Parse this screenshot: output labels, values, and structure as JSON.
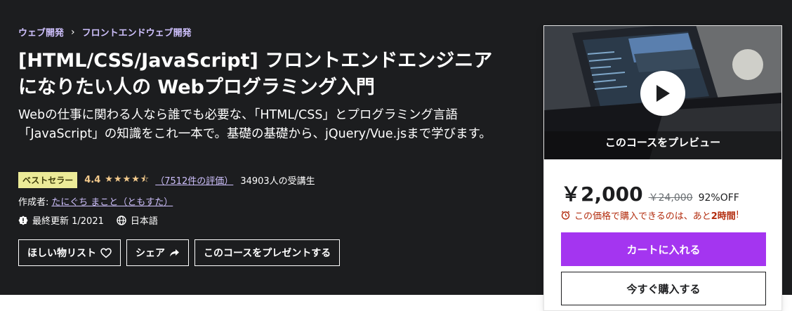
{
  "breadcrumb": {
    "items": [
      "ウェブ開発",
      "フロントエンドウェブ開発"
    ],
    "separator": "›"
  },
  "course": {
    "title": "[HTML/CSS/JavaScript] フロントエンドエンジニアになりたい人の Webプログラミング入門",
    "subtitle": "Webの仕事に関わる人なら誰でも必要な、「HTML/CSS」とプログラミング言語「JavaScript」の知識をこれ一本で。基礎の基礎から、jQuery/Vue.jsまで学びます。",
    "badge": "ベストセラー",
    "rating": "4.4",
    "stars": "★★★★⯪",
    "rating_count": "（7512件の評価）",
    "students": "34903人の受講生",
    "author_label": "作成者:",
    "author": "たにぐち まこと（ともすた）",
    "last_updated": "最終更新 1/2021",
    "language": "日本語"
  },
  "actions": {
    "wishlist": "ほしい物リスト",
    "share": "シェア",
    "gift": "このコースをプレゼントする"
  },
  "card": {
    "preview_label": "このコースをプレビュー",
    "price": "￥2,000",
    "original_price": "￥24,000",
    "discount": "92%OFF",
    "timer_text": "この価格で購入できるのは、あと",
    "timer_value": "2時間",
    "timer_suffix": "!",
    "add_to_cart": "カートに入れる",
    "buy_now": "今すぐ購入する"
  },
  "colors": {
    "hero_bg": "#1c1d1f",
    "accent_purple": "#a435f0",
    "link_purple": "#cec0fc",
    "star": "#f3ca8c",
    "badge_bg": "#eceb98",
    "alert_red": "#b32d0f"
  }
}
